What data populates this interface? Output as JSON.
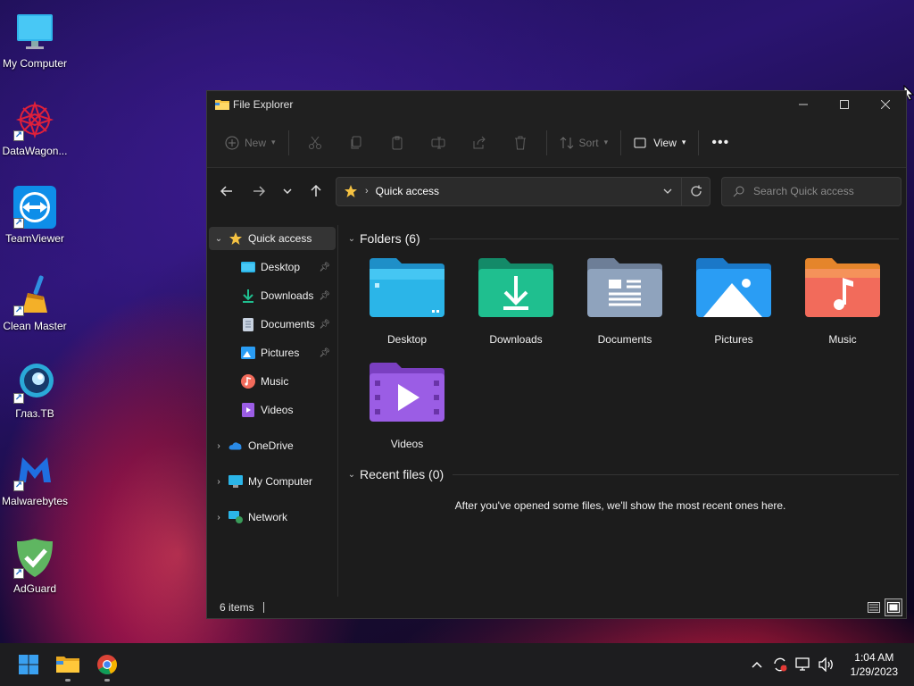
{
  "desktop": {
    "icons": [
      {
        "label": "My Computer",
        "icon": "monitor-icon"
      },
      {
        "label": "DataWagon...",
        "icon": "datawagon-icon"
      },
      {
        "label": "TeamViewer",
        "icon": "teamviewer-icon"
      },
      {
        "label": "Clean Master",
        "icon": "broom-icon"
      },
      {
        "label": "Глаз.ТВ",
        "icon": "glaz-tv-icon"
      },
      {
        "label": "Malwarebytes",
        "icon": "malwarebytes-icon"
      },
      {
        "label": "AdGuard",
        "icon": "adguard-shield-icon"
      }
    ]
  },
  "window": {
    "title": "File Explorer",
    "commandbar": {
      "new_label": "New",
      "sort_label": "Sort",
      "view_label": "View"
    },
    "address": {
      "crumb": "Quick access"
    },
    "search": {
      "placeholder": "Search Quick access"
    },
    "nav": {
      "quick_access": "Quick access",
      "pinned": [
        {
          "label": "Desktop",
          "pinned": true
        },
        {
          "label": "Downloads",
          "pinned": true
        },
        {
          "label": "Documents",
          "pinned": true
        },
        {
          "label": "Pictures",
          "pinned": true
        },
        {
          "label": "Music",
          "pinned": false
        },
        {
          "label": "Videos",
          "pinned": false
        }
      ],
      "onedrive": "OneDrive",
      "mycomputer": "My Computer",
      "network": "Network"
    },
    "content": {
      "folders_header": "Folders (6)",
      "folders": [
        {
          "label": "Desktop",
          "color": "#2bb5e8"
        },
        {
          "label": "Downloads",
          "color": "#1fbf8f"
        },
        {
          "label": "Documents",
          "color": "#8fa3bd"
        },
        {
          "label": "Pictures",
          "color": "#2a9df4"
        },
        {
          "label": "Music",
          "color": "#f26b5b"
        },
        {
          "label": "Videos",
          "color": "#9b5de5"
        }
      ],
      "recent_header": "Recent files (0)",
      "recent_empty": "After you've opened some files, we'll show the most recent ones here."
    },
    "status": {
      "items": "6 items"
    }
  },
  "taskbar": {
    "time": "1:04 AM",
    "date": "1/29/2023"
  }
}
